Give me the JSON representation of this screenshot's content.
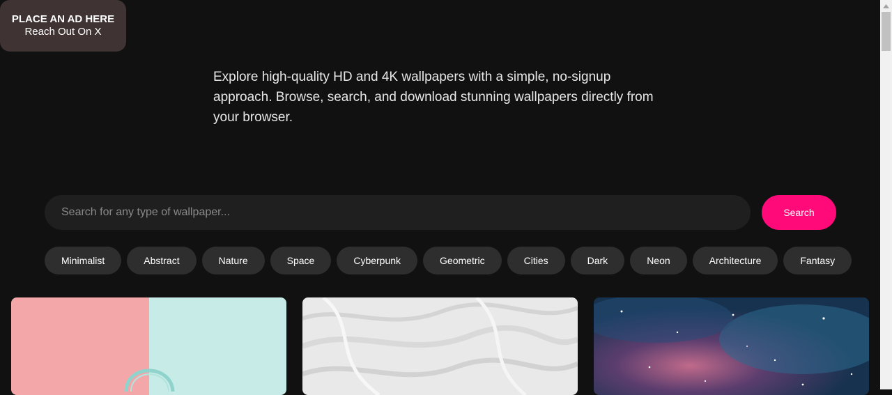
{
  "ad": {
    "title": "PLACE AN AD HERE",
    "subtitle": "Reach Out On X"
  },
  "intro": {
    "text": "Explore high-quality HD and 4K wallpapers with a simple, no-signup approach. Browse, search, and download stunning wallpapers directly from your browser."
  },
  "search": {
    "placeholder": "Search for any type of wallpaper...",
    "value": "",
    "button_label": "Search"
  },
  "categories": [
    "Minimalist",
    "Abstract",
    "Nature",
    "Space",
    "Cyberpunk",
    "Geometric",
    "Cities",
    "Dark",
    "Neon",
    "Architecture",
    "Fantasy"
  ],
  "wallpapers": [
    {
      "subject": "pastel pink and mint with headphones"
    },
    {
      "subject": "white textured plaster"
    },
    {
      "subject": "blue and pink galaxy starfield"
    }
  ],
  "colors": {
    "background": "#111111",
    "accent": "#ff0a78",
    "tag_bg": "#2e2e2e",
    "input_bg": "#1f1f1f",
    "ad_bg": "#3f3333"
  }
}
